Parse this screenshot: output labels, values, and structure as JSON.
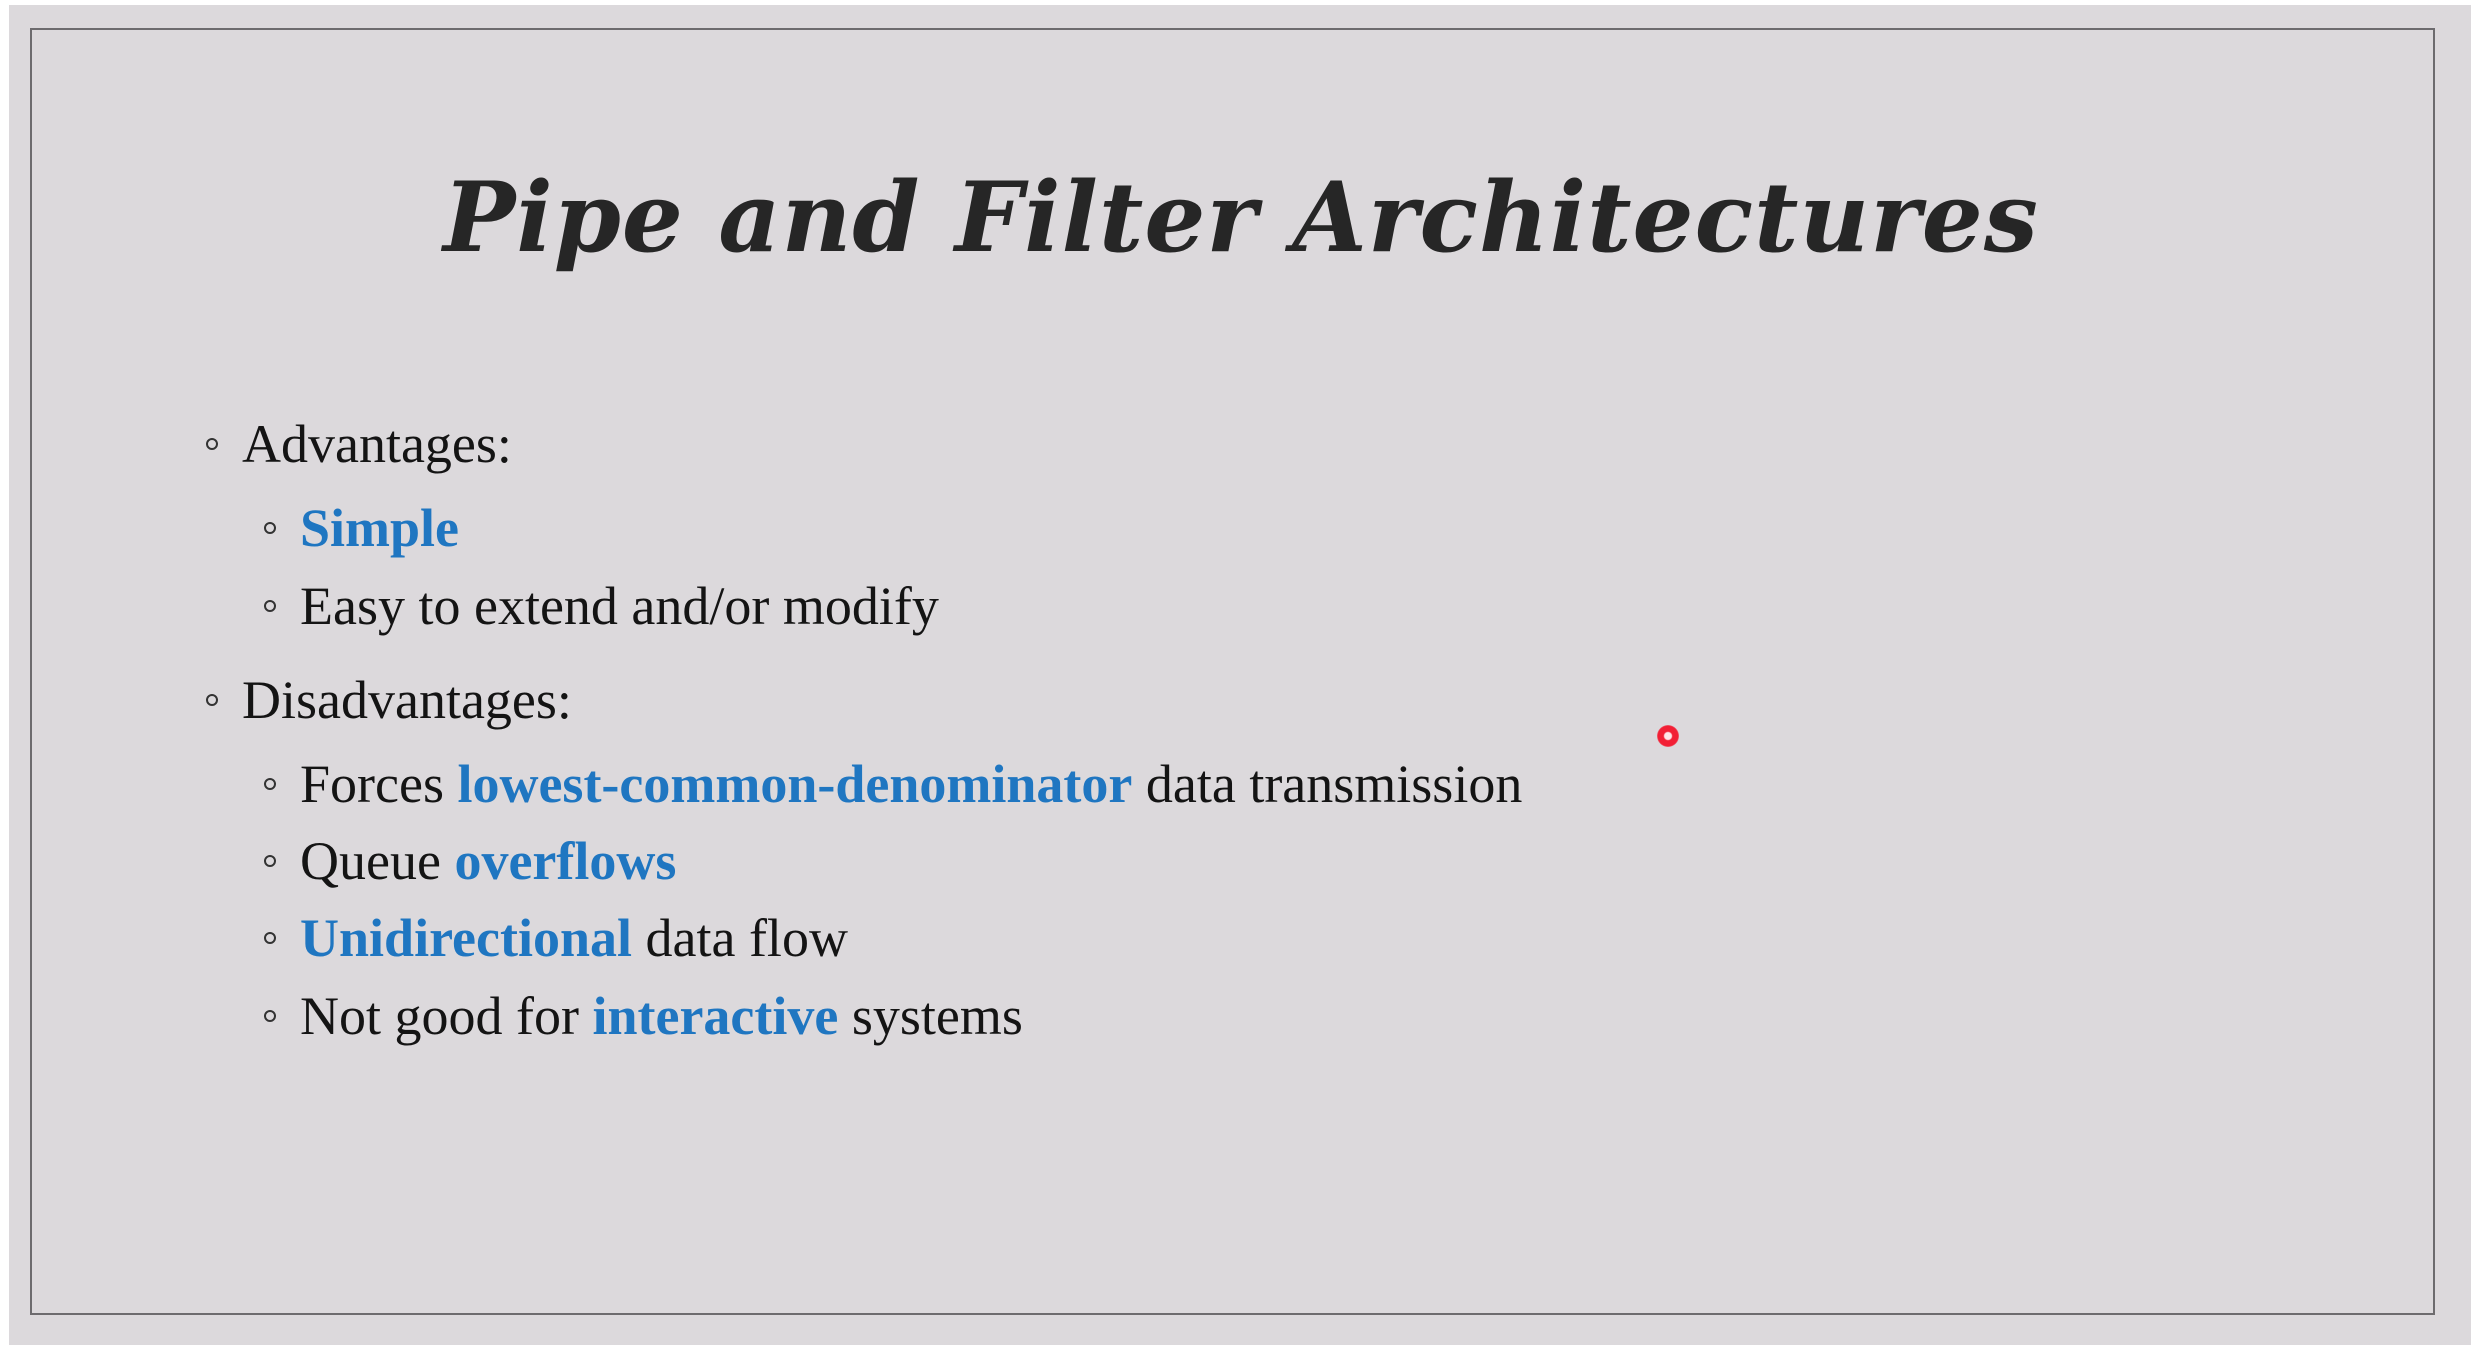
{
  "slide": {
    "title": "Pipe and Filter Architectures",
    "advantages_heading": "Advantages:",
    "advantages": [
      {
        "text": "Simple"
      },
      {
        "text": "Easy to extend and/or modify"
      }
    ],
    "disadvantages_heading": "Disadvantages:",
    "disadvantages": [
      {
        "before": "Forces ",
        "highlight": "lowest-common-denominator",
        "after": " data transmission"
      },
      {
        "before": "Queue ",
        "highlight": "overflows",
        "after": ""
      },
      {
        "before": "",
        "highlight": "Unidirectional",
        "after": " data flow"
      },
      {
        "before": "Not good for ",
        "highlight": "interactive",
        "after": " systems"
      }
    ]
  },
  "colors": {
    "slide_background": "#dcd9dc",
    "border": "#6d6b6e",
    "title_text": "#262626",
    "body_text": "#141414",
    "highlight": "#1f76c1",
    "laser_pointer": "#f21f35"
  },
  "icons": {
    "bullet": "hollow-circle-bullet-icon",
    "pointer": "laser-pointer-icon"
  }
}
